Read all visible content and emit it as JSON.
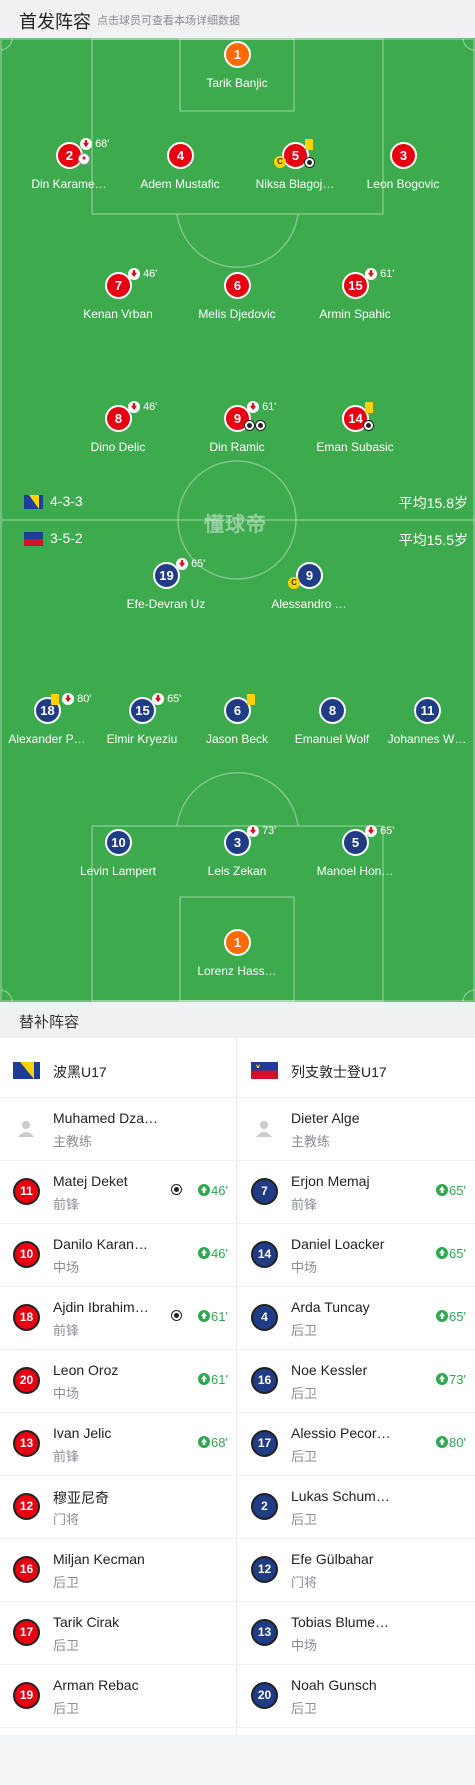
{
  "header": {
    "title": "首发阵容",
    "hint": "点击球员可查看本场详细数据"
  },
  "pitch": {
    "watermark": "懂球帝",
    "home": {
      "formation": "4-3-3",
      "avg_age": "平均15.8岁"
    },
    "away": {
      "formation": "3-5-2",
      "avg_age": "平均15.5岁"
    }
  },
  "home_players": [
    {
      "number": "1",
      "name": "Tarik Banjic",
      "kit": "orange"
    },
    {
      "number": "2",
      "name": "Din Karame…",
      "kit": "red",
      "sub_min": "68'"
    },
    {
      "number": "4",
      "name": "Adem Mustafic",
      "kit": "red"
    },
    {
      "number": "5",
      "name": "Niksa Blagoj…",
      "kit": "red"
    },
    {
      "number": "3",
      "name": "Leon Bogovic",
      "kit": "red"
    },
    {
      "number": "7",
      "name": "Kenan Vrban",
      "kit": "red",
      "sub_min": "46'"
    },
    {
      "number": "6",
      "name": "Melis Djedovic",
      "kit": "red"
    },
    {
      "number": "15",
      "name": "Armin Spahic",
      "kit": "red",
      "sub_min": "61'"
    },
    {
      "number": "8",
      "name": "Dino Delic",
      "kit": "red",
      "sub_min": "46'"
    },
    {
      "number": "9",
      "name": "Din Ramic",
      "kit": "red",
      "sub_min": "61'"
    },
    {
      "number": "14",
      "name": "Eman Subasic",
      "kit": "red"
    }
  ],
  "away_players": [
    {
      "number": "19",
      "name": "Efe-Devran Uz",
      "kit": "blue",
      "sub_min": "65'"
    },
    {
      "number": "9",
      "name": "Alessandro …",
      "kit": "blue"
    },
    {
      "number": "18",
      "name": "Alexander P…",
      "kit": "blue",
      "sub_min": "80'"
    },
    {
      "number": "15",
      "name": "Elmir Kryeziu",
      "kit": "blue",
      "sub_min": "65'"
    },
    {
      "number": "6",
      "name": "Jason Beck",
      "kit": "blue"
    },
    {
      "number": "8",
      "name": "Emanuel Wolf",
      "kit": "blue"
    },
    {
      "number": "11",
      "name": "Johannes W…",
      "kit": "blue"
    },
    {
      "number": "10",
      "name": "Levin Lampert",
      "kit": "blue"
    },
    {
      "number": "3",
      "name": "Leis Zekan",
      "kit": "blue",
      "sub_min": "73'"
    },
    {
      "number": "5",
      "name": "Manoel Hon…",
      "kit": "blue",
      "sub_min": "65'"
    },
    {
      "number": "1",
      "name": "Lorenz Hass…",
      "kit": "orange"
    }
  ],
  "icons": {
    "captain": "C",
    "substituted_off": "sub-off-icon",
    "yellow_card": "yellow-card-icon",
    "goal": "ball-icon"
  },
  "subs": {
    "title": "替补阵容",
    "home": {
      "team": "波黑U17",
      "coach": {
        "name": "Muhamed Dzakmic",
        "role": "主教练"
      },
      "players": [
        {
          "number": "11",
          "name": "Matej Deket",
          "pos": "前锋",
          "minute": "46'",
          "goal": true
        },
        {
          "number": "10",
          "name": "Danilo Karan…",
          "pos": "中场",
          "minute": "46'"
        },
        {
          "number": "18",
          "name": "Ajdin Ibrahim…",
          "pos": "前锋",
          "minute": "61'",
          "goal": true
        },
        {
          "number": "20",
          "name": "Leon Oroz",
          "pos": "中场",
          "minute": "61'"
        },
        {
          "number": "13",
          "name": "Ivan Jelic",
          "pos": "前锋",
          "minute": "68'"
        },
        {
          "number": "12",
          "name": "穆亚尼奇",
          "pos": "门将",
          "minute": ""
        },
        {
          "number": "16",
          "name": "Miljan Kecman",
          "pos": "后卫",
          "minute": ""
        },
        {
          "number": "17",
          "name": "Tarik Cirak",
          "pos": "后卫",
          "minute": ""
        },
        {
          "number": "19",
          "name": "Arman Rebac",
          "pos": "后卫",
          "minute": ""
        }
      ]
    },
    "away": {
      "team": "列支敦士登U17",
      "coach": {
        "name": "Dieter Alge",
        "role": "主教练"
      },
      "players": [
        {
          "number": "7",
          "name": "Erjon Memaj",
          "pos": "前锋",
          "minute": "65'"
        },
        {
          "number": "14",
          "name": "Daniel Loacker",
          "pos": "中场",
          "minute": "65'"
        },
        {
          "number": "4",
          "name": "Arda Tuncay",
          "pos": "后卫",
          "minute": "65'"
        },
        {
          "number": "16",
          "name": "Noe Kessler",
          "pos": "后卫",
          "minute": "73'"
        },
        {
          "number": "17",
          "name": "Alessio Pecor…",
          "pos": "后卫",
          "minute": "80'"
        },
        {
          "number": "2",
          "name": "Lukas Schum…",
          "pos": "后卫",
          "minute": ""
        },
        {
          "number": "12",
          "name": "Efe Gülbahar",
          "pos": "门将",
          "minute": ""
        },
        {
          "number": "13",
          "name": "Tobias Blume…",
          "pos": "中场",
          "minute": ""
        },
        {
          "number": "20",
          "name": "Noah Gunsch",
          "pos": "后卫",
          "minute": ""
        }
      ]
    }
  }
}
